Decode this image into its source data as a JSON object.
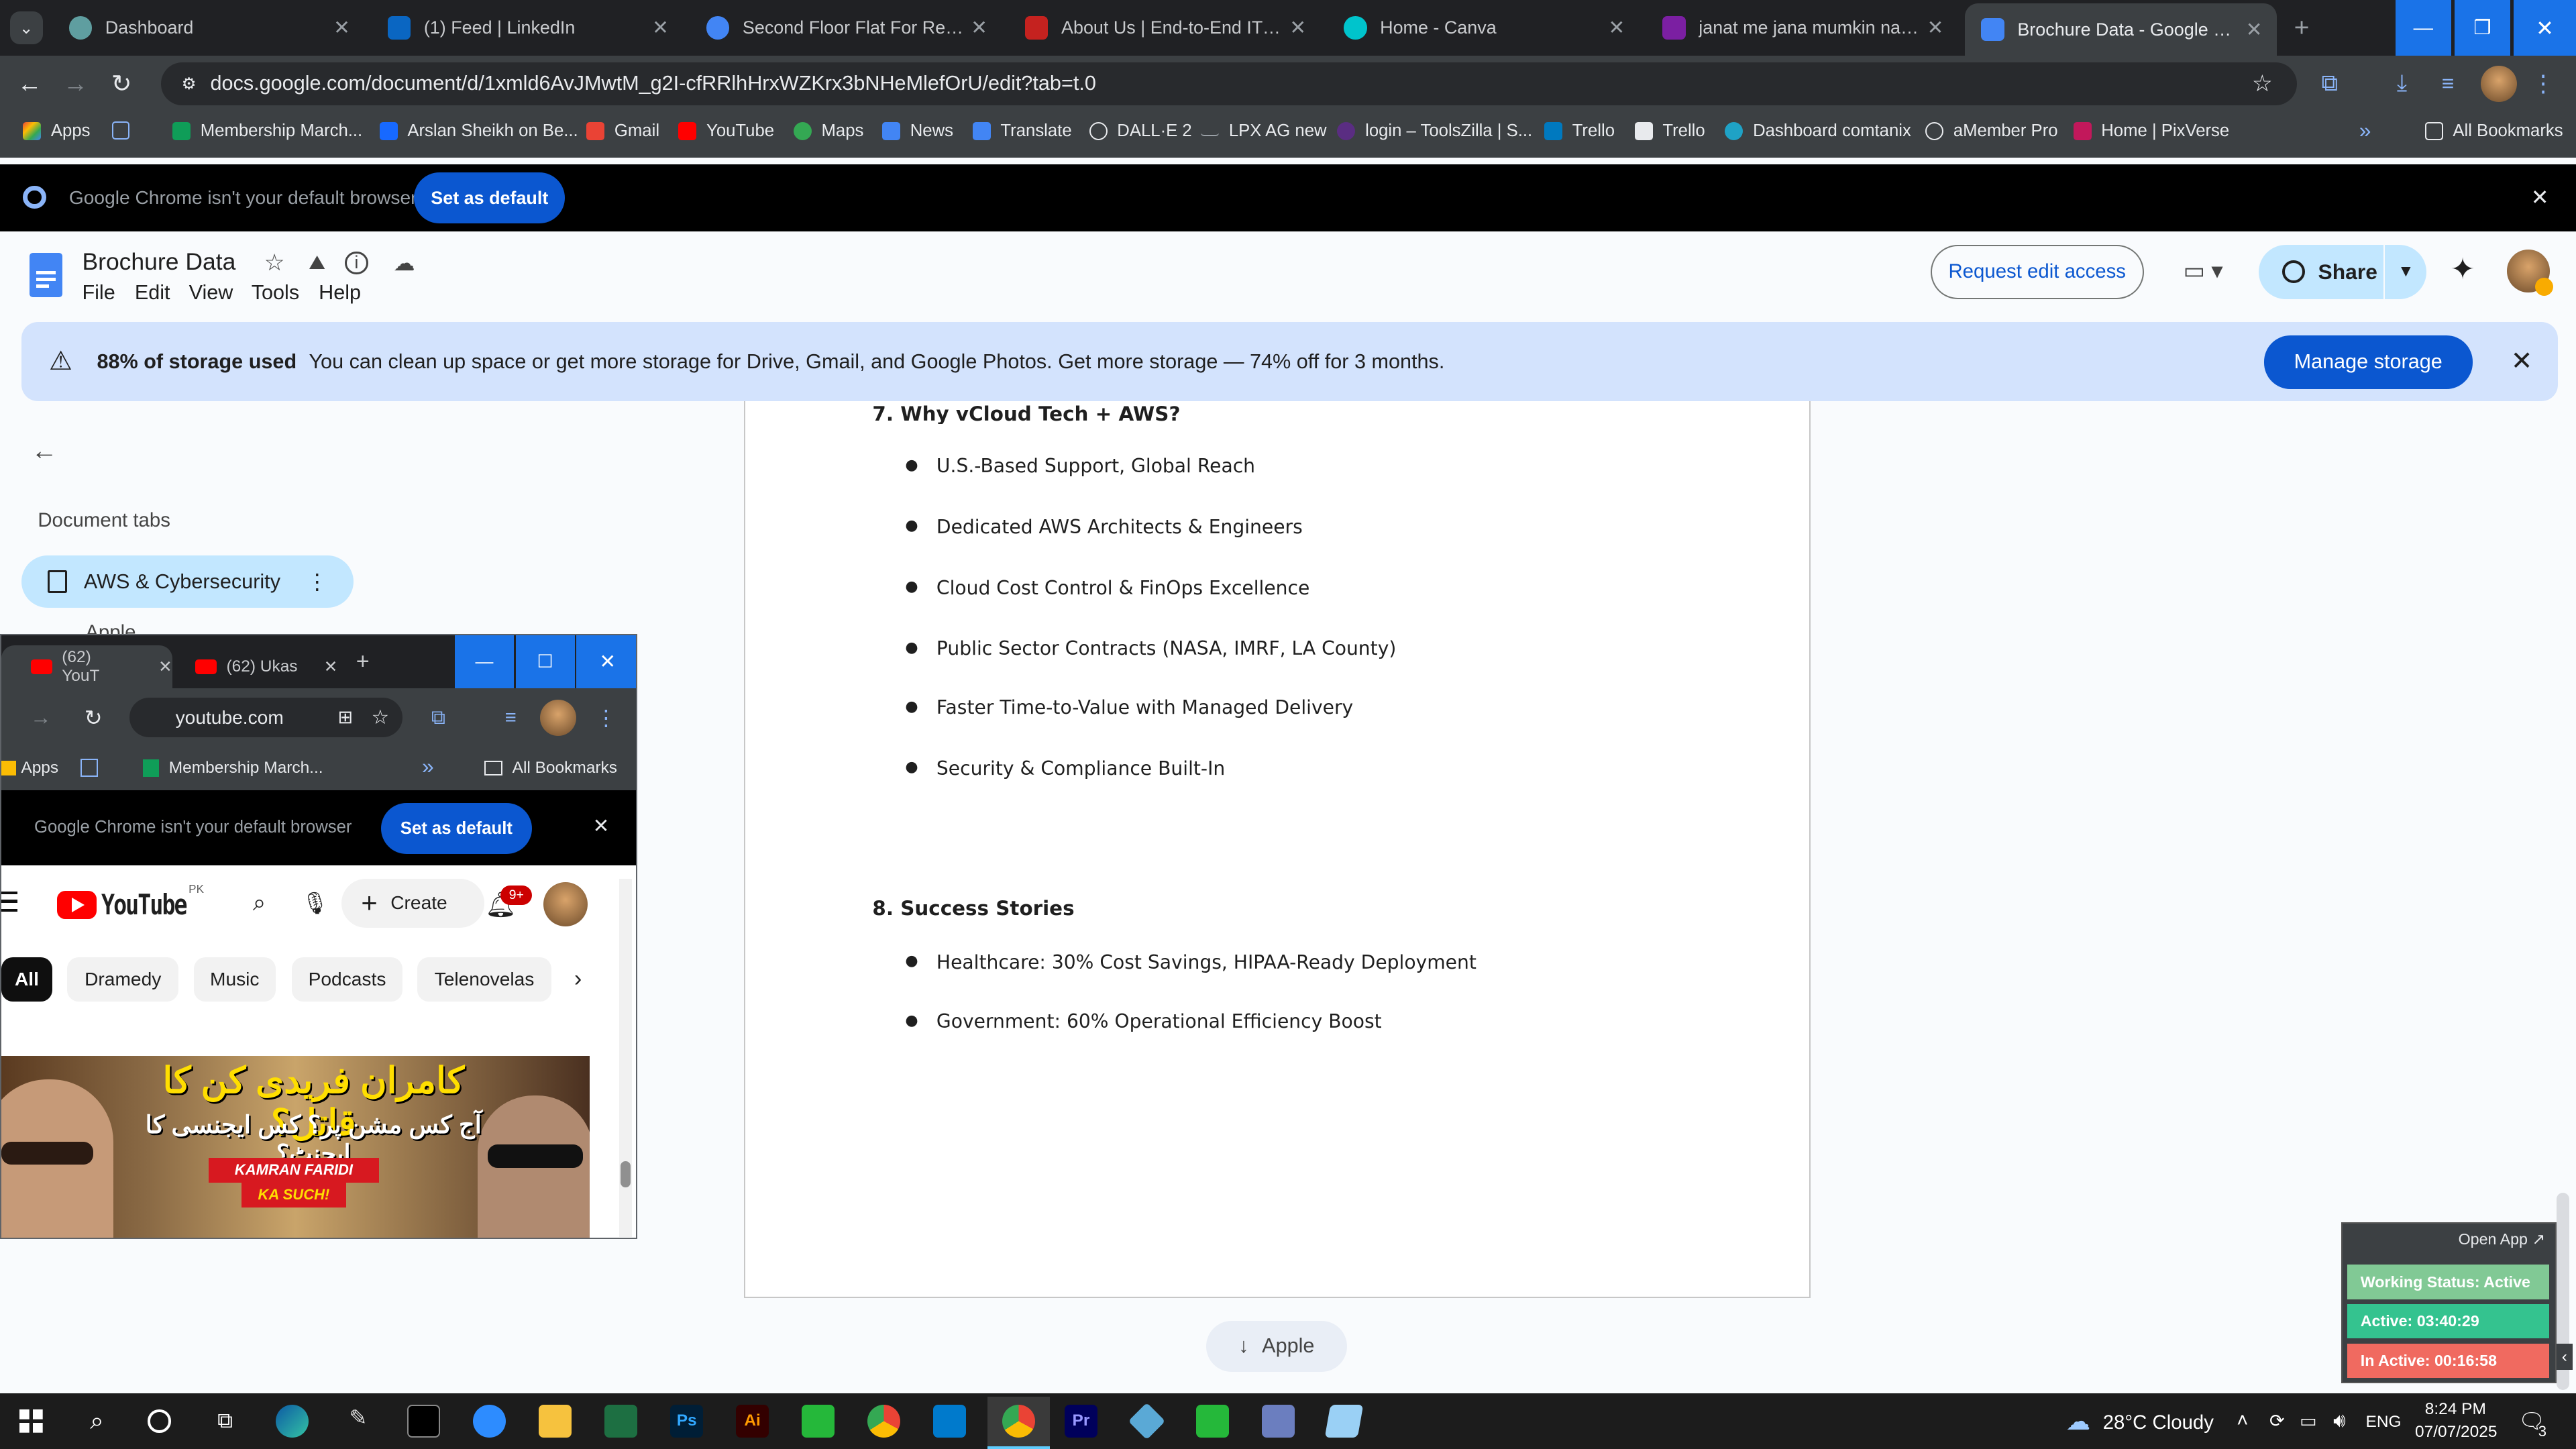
{
  "browser": {
    "tabs": [
      {
        "title": "Dashboard",
        "color": "#5f9ea0"
      },
      {
        "title": "(1) Feed | LinkedIn",
        "color": "#0a66c2"
      },
      {
        "title": "Second Floor Flat For Rent at A",
        "color": "#4285f4"
      },
      {
        "title": "About Us | End-to-End IT Soluti",
        "color": "#c5221f"
      },
      {
        "title": "Home - Canva",
        "color": "#00c4cc"
      },
      {
        "title": "janat me jana mumkin nai - Mu",
        "color": "#7b1fa2"
      },
      {
        "title": "Brochure Data - Google Docs",
        "color": "#4285f4"
      }
    ],
    "url": "docs.google.com/document/d/1xmld6AvJMwtM_g2I-cfRRlhHrxWZKrx3bNHeMlefOrU/edit?tab=t.0",
    "bookmarks": [
      "Apps",
      "Membership March...",
      "Arslan Sheikh on Be...",
      "Gmail",
      "YouTube",
      "Maps",
      "News",
      "Translate",
      "DALL·E 2",
      "LPX AG new",
      "login – ToolsZilla | S...",
      "Trello",
      "Trello",
      "Dashboard comtanix",
      "aMember Pro",
      "Home | PixVerse"
    ],
    "all_bookmarks": "All Bookmarks",
    "default_msg": "Google Chrome isn't your default browser",
    "set_default": "Set as default"
  },
  "docs": {
    "title": "Brochure Data",
    "menu": [
      "File",
      "Edit",
      "View",
      "Tools",
      "Help"
    ],
    "request_edit": "Request edit access",
    "share": "Share",
    "storage_bold": "88% of storage used",
    "storage_text": "You can clean up space or get more storage for Drive, Gmail, and Google Photos. Get more storage — 74% off for 3 months.",
    "manage_storage": "Manage storage",
    "document_tabs": "Document tabs",
    "tab_active": "AWS & Cybersecurity",
    "tab_next": "Apple",
    "section7": "7. Why vCloud Tech + AWS?",
    "bullets7": [
      "U.S.-Based Support, Global Reach",
      "Dedicated AWS Architects & Engineers",
      "Cloud Cost Control & FinOps Excellence",
      "Public Sector Contracts (NASA, IMRF, LA County)",
      "Faster Time-to-Value with Managed Delivery",
      "Security & Compliance Built-In"
    ],
    "section8": "8. Success Stories",
    "bullets8": [
      "Healthcare: 30% Cost Savings, HIPAA-Ready Deployment",
      "Government: 60% Operational Efficiency Boost"
    ],
    "next_tab_button": "Apple"
  },
  "youtube_window": {
    "tabs": [
      "(62) YouT",
      "(62) Ukas"
    ],
    "url": "youtube.com",
    "bookmarks": [
      "Apps",
      "Membership March..."
    ],
    "all_bookmarks": "All Bookmarks",
    "default_msg": "Google Chrome isn't your default browser",
    "set_default": "Set as default",
    "logo": "YouTube",
    "region": "PK",
    "create": "Create",
    "notif": "9+",
    "chips": [
      "All",
      "Dramedy",
      "Music",
      "Podcasts",
      "Telenovelas"
    ],
    "thumb_title": "کامران فریدی کن کا قاتل؟",
    "thumb_sub": "آج کس مشن پر؟ کس ایجنسی کا ایجنٹ؟",
    "thumb_tag1": "KAMRAN FARIDI",
    "thumb_tag2": "KA SUCH!"
  },
  "widget": {
    "open_app": "Open App ↗",
    "status": "Working Status: Active",
    "active": "Active: 03:40:29",
    "inactive": "In Active: 00:16:58"
  },
  "taskbar": {
    "weather": "28°C  Cloudy",
    "lang": "ENG",
    "time": "8:24 PM",
    "date": "07/07/2025",
    "notif_count": "3"
  }
}
